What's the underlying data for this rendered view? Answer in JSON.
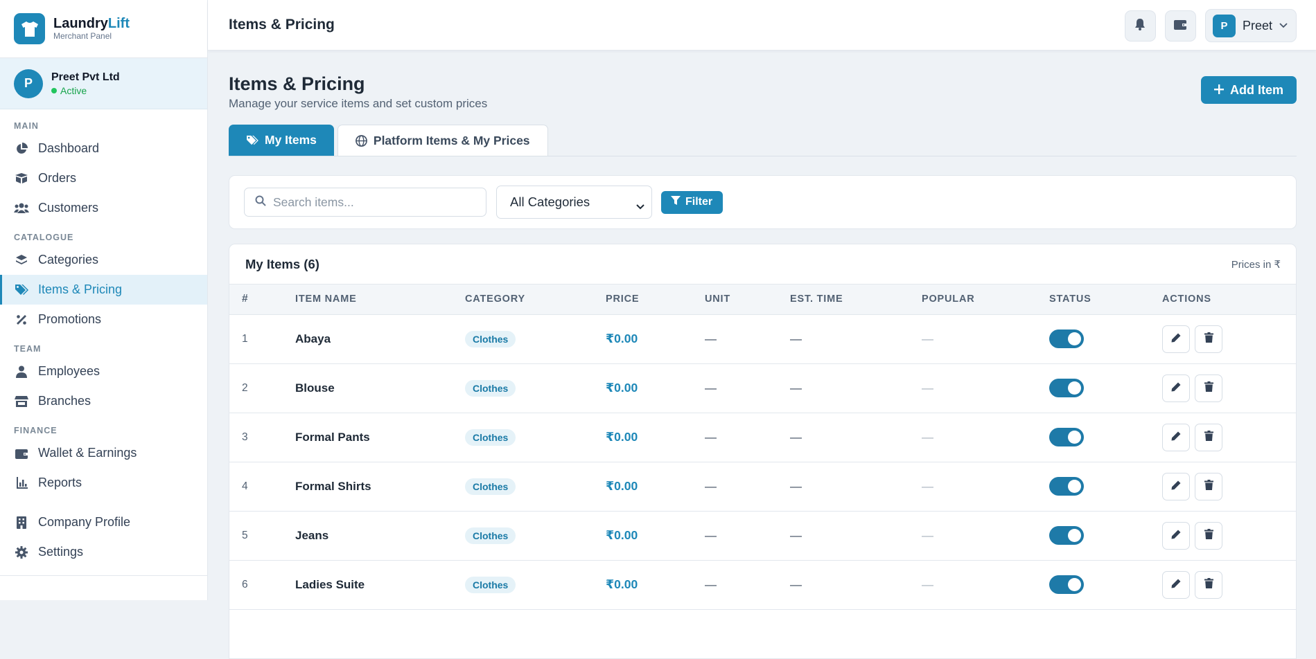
{
  "brand": {
    "name_part1": "Laundry",
    "name_part2": "Lift",
    "subtitle": "Merchant Panel"
  },
  "account": {
    "initial": "P",
    "name": "Preet Pvt Ltd",
    "status": "Active"
  },
  "sidebar": {
    "sections": [
      {
        "label": "MAIN",
        "items": [
          {
            "label": "Dashboard",
            "icon": "chart-pie-icon"
          },
          {
            "label": "Orders",
            "icon": "box-open-icon"
          },
          {
            "label": "Customers",
            "icon": "users-icon"
          }
        ]
      },
      {
        "label": "CATALOGUE",
        "items": [
          {
            "label": "Categories",
            "icon": "layers-icon"
          },
          {
            "label": "Items & Pricing",
            "icon": "tags-icon",
            "active": true
          },
          {
            "label": "Promotions",
            "icon": "percent-icon"
          }
        ]
      },
      {
        "label": "TEAM",
        "items": [
          {
            "label": "Employees",
            "icon": "user-tie-icon"
          },
          {
            "label": "Branches",
            "icon": "store-icon"
          }
        ]
      },
      {
        "label": "FINANCE",
        "items": [
          {
            "label": "Wallet & Earnings",
            "icon": "wallet-icon"
          },
          {
            "label": "Reports",
            "icon": "bar-chart-icon"
          }
        ]
      },
      {
        "label": "",
        "items": [
          {
            "label": "Company Profile",
            "icon": "building-icon"
          },
          {
            "label": "Settings",
            "icon": "gear-icon"
          }
        ]
      }
    ]
  },
  "topbar": {
    "title": "Items & Pricing",
    "user": {
      "initial": "P",
      "name": "Preet"
    }
  },
  "page": {
    "title": "Items & Pricing",
    "subtitle": "Manage your service items and set custom prices",
    "add_label": "Add Item"
  },
  "tabs": [
    {
      "label": "My Items",
      "icon": "tags-icon",
      "active": true
    },
    {
      "label": "Platform Items & My Prices",
      "icon": "globe-icon",
      "active": false
    }
  ],
  "filters": {
    "search_placeholder": "Search items...",
    "category_value": "All Categories",
    "filter_label": "Filter"
  },
  "table": {
    "title": "My Items (6)",
    "note": "Prices in ₹",
    "columns": [
      "#",
      "ITEM NAME",
      "CATEGORY",
      "PRICE",
      "UNIT",
      "EST. TIME",
      "POPULAR",
      "STATUS",
      "ACTIONS"
    ],
    "rows": [
      {
        "num": "1",
        "name": "Abaya",
        "category": "Clothes",
        "price": "₹0.00",
        "unit": "—",
        "est_time": "—",
        "popular": "—",
        "status_on": true
      },
      {
        "num": "2",
        "name": "Blouse",
        "category": "Clothes",
        "price": "₹0.00",
        "unit": "—",
        "est_time": "—",
        "popular": "—",
        "status_on": true
      },
      {
        "num": "3",
        "name": "Formal Pants",
        "category": "Clothes",
        "price": "₹0.00",
        "unit": "—",
        "est_time": "—",
        "popular": "—",
        "status_on": true
      },
      {
        "num": "4",
        "name": "Formal Shirts",
        "category": "Clothes",
        "price": "₹0.00",
        "unit": "—",
        "est_time": "—",
        "popular": "—",
        "status_on": true
      },
      {
        "num": "5",
        "name": "Jeans",
        "category": "Clothes",
        "price": "₹0.00",
        "unit": "—",
        "est_time": "—",
        "popular": "—",
        "status_on": true
      },
      {
        "num": "6",
        "name": "Ladies Suite",
        "category": "Clothes",
        "price": "₹0.00",
        "unit": "—",
        "est_time": "—",
        "popular": "—",
        "status_on": true
      }
    ]
  },
  "colors": {
    "accent": "#1e88b8",
    "background": "#eef2f6",
    "active_status": "#22c55e"
  }
}
